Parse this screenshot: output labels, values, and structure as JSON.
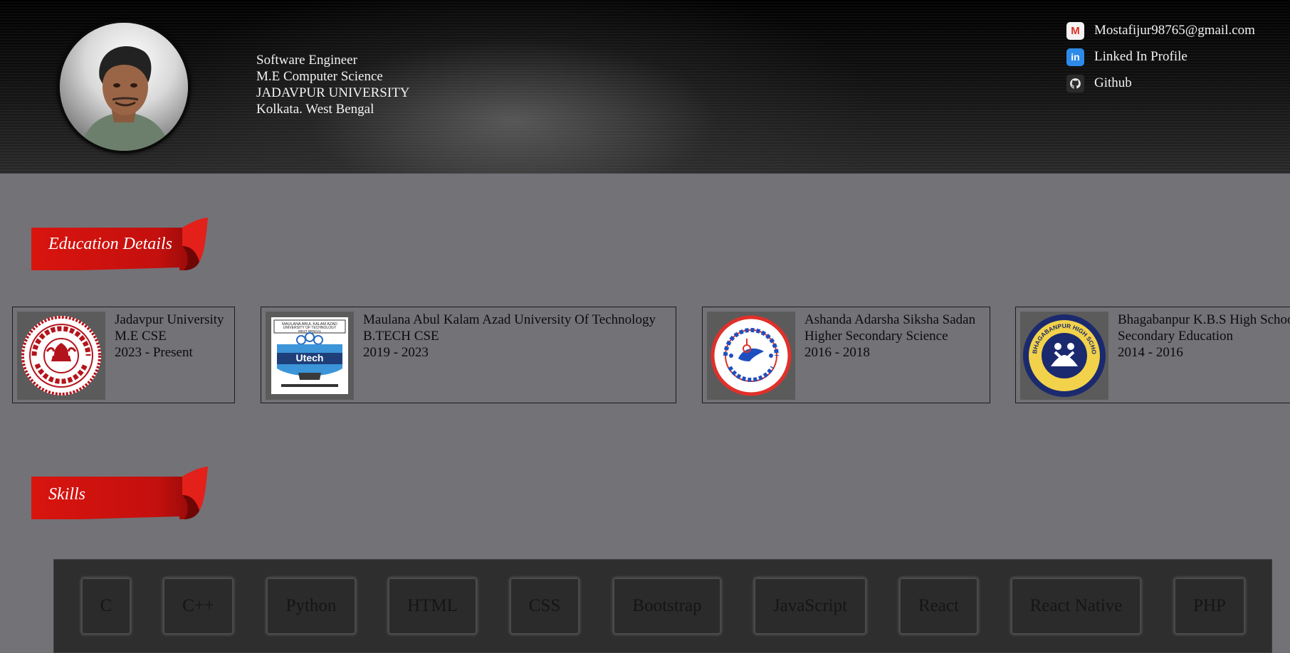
{
  "profile": {
    "lines": [
      "Software Engineer",
      "M.E Computer Science",
      "JADAVPUR UNIVERSITY",
      "Kolkata. West Bengal"
    ]
  },
  "contacts": [
    {
      "label": "Mostafijur98765@gmail.com",
      "icon": "gmail-icon"
    },
    {
      "label": "Linked In Profile",
      "icon": "linkedin-icon"
    },
    {
      "label": "Github",
      "icon": "github-icon"
    }
  ],
  "sections": {
    "education_title": "Education Details",
    "skills_title": "Skills"
  },
  "education": [
    {
      "institution": "Jadavpur University",
      "degree": "M.E CSE",
      "years": "2023 - Present",
      "logo": "jadavpur-university-logo"
    },
    {
      "institution": "Maulana Abul Kalam Azad University Of Technology",
      "degree": "B.TECH CSE",
      "years": "2019 - 2023",
      "logo": "makaut-logo",
      "logo_text": "Utech",
      "logo_caption": "MAULANA ABUL KALAM AZAD UNIVERSITY OF TECHNOLOGY WEST BENGAL"
    },
    {
      "institution": "Ashanda Adarsha Siksha Sadan",
      "degree": "Higher Secondary Science",
      "years": "2016 - 2018",
      "logo": "ashanda-school-logo"
    },
    {
      "institution": "Bhagabanpur K.B.S High School",
      "degree": "Secondary Education",
      "years": "2014 - 2016",
      "logo": "bhagabanpur-school-logo",
      "logo_text": "BHAGABANPUR HIGH SCHOOL (H.S)"
    }
  ],
  "skills": [
    "C",
    "C++",
    "Python",
    "HTML",
    "CSS",
    "Bootstrap",
    "JavaScript",
    "React",
    "React Native",
    "PHP"
  ],
  "colors": {
    "ribbon": "#c8100f",
    "background": "#737277",
    "skills_panel": "#2e2e2e"
  }
}
